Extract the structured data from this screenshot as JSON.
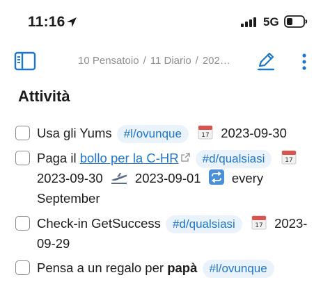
{
  "status_bar": {
    "time": "11:16",
    "network": "5G"
  },
  "toolbar": {
    "breadcrumb": [
      "10 Pensatoio",
      "11 Diario",
      "202…"
    ],
    "separator": "/"
  },
  "section": {
    "title": "Attività"
  },
  "tasks": [
    {
      "text": "Usa gli Yums",
      "tag": "#l/ovunque",
      "scheduled_icon": "calendar-icon",
      "scheduled": "2023-09-30",
      "checked": false
    },
    {
      "prefix": "Paga il",
      "link": "bollo per la C-HR",
      "tag": "#d/qualsiasi",
      "scheduled_icon": "calendar-icon",
      "scheduled": "2023-09-30",
      "start_icon": "airplane-departure-icon",
      "start": "2023-09-01",
      "recurrence_icon": "repeat-icon",
      "recurrence": "every September",
      "checked": false
    },
    {
      "text": "Check-in GetSuccess",
      "tag": "#d/qualsiasi",
      "scheduled_icon": "calendar-icon",
      "scheduled": "2023-09-29",
      "checked": false
    },
    {
      "text": "Pensa a un regalo per",
      "bold": "papà",
      "tag": "#l/ovunque",
      "checked": false
    }
  ],
  "colors": {
    "accent": "#1e76c8",
    "tag_bg": "#eaf3fb",
    "muted": "#8e8e93"
  }
}
